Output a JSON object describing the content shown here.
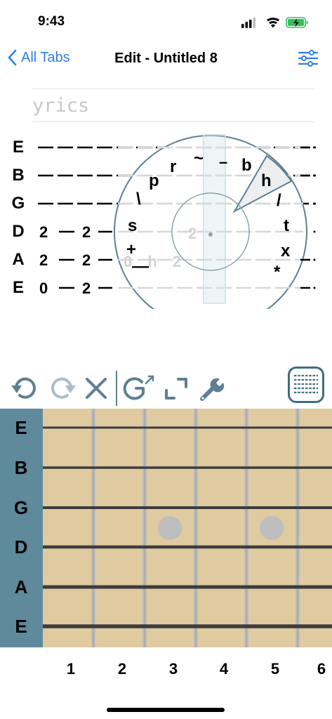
{
  "status": {
    "time": "9:43"
  },
  "nav": {
    "back_label": "All Tabs",
    "title": "Edit - Untitled 8"
  },
  "lyrics": {
    "placeholder": "yrics"
  },
  "tab": {
    "strings": [
      "E",
      "B",
      "G",
      "D",
      "A",
      "E"
    ],
    "rows": [
      {
        "string": "E",
        "notes": []
      },
      {
        "string": "B",
        "notes": []
      },
      {
        "string": "G",
        "notes": []
      },
      {
        "string": "D",
        "notes": [
          "2",
          "2"
        ]
      },
      {
        "string": "A",
        "notes": [
          "2",
          "2"
        ]
      },
      {
        "string": "E",
        "notes": [
          "0",
          "2"
        ]
      }
    ],
    "faded": {
      "d_note": "2",
      "a_notes": "0 h 2"
    }
  },
  "wheel": {
    "symbols": [
      "~",
      "–",
      "b",
      "h",
      "/",
      "t",
      "x",
      "*",
      "—",
      "+",
      "s",
      "\\",
      "p",
      "r"
    ],
    "selected": "h"
  },
  "toolbar": {
    "icons": [
      "undo-icon",
      "redo-icon",
      "clear-icon",
      "chord-icon",
      "expand-icon",
      "wrench-icon",
      "tab-view-icon"
    ]
  },
  "fretboard": {
    "strings": [
      "E",
      "B",
      "G",
      "D",
      "A",
      "E"
    ],
    "fret_numbers": [
      "1",
      "2",
      "3",
      "4",
      "5",
      "6"
    ],
    "markers_at_frets": [
      3,
      5
    ],
    "colors": {
      "wood": "#e0caa0",
      "side": "#5f8a9c",
      "fret": "#a8a8a8",
      "string": "#3d3d3d",
      "marker": "#bbbbbb"
    }
  },
  "colors": {
    "accent": "#2f7ee8",
    "wheel": "#5d8090"
  }
}
